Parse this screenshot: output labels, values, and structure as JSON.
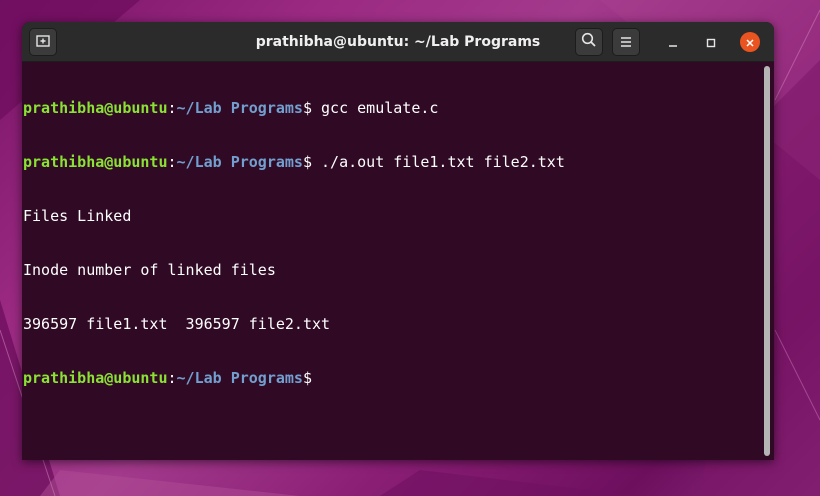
{
  "window": {
    "title": "prathibha@ubuntu: ~/Lab Programs"
  },
  "titlebar": {
    "new_tab_icon": "new-tab-icon",
    "search_icon": "search-icon",
    "menu_icon": "hamburger-menu-icon",
    "minimize_icon": "minimize-icon",
    "maximize_icon": "maximize-icon",
    "close_icon": "close-icon"
  },
  "colors": {
    "terminal_bg": "#300a24",
    "prompt_user": "#8ae234",
    "prompt_path": "#729fcf",
    "close_button": "#e95420",
    "titlebar_bg": "#2b2b2b"
  },
  "terminal": {
    "lines": [
      {
        "user": "prathibha@ubuntu",
        "sep": ":",
        "path": "~/Lab Programs",
        "dollar": "$",
        "cmd": " gcc emulate.c"
      },
      {
        "user": "prathibha@ubuntu",
        "sep": ":",
        "path": "~/Lab Programs",
        "dollar": "$",
        "cmd": " ./a.out file1.txt file2.txt"
      },
      {
        "output": "Files Linked"
      },
      {
        "output": "Inode number of linked files"
      },
      {
        "output": "396597 file1.txt  396597 file2.txt"
      },
      {
        "user": "prathibha@ubuntu",
        "sep": ":",
        "path": "~/Lab Programs",
        "dollar": "$",
        "cmd": ""
      }
    ]
  }
}
